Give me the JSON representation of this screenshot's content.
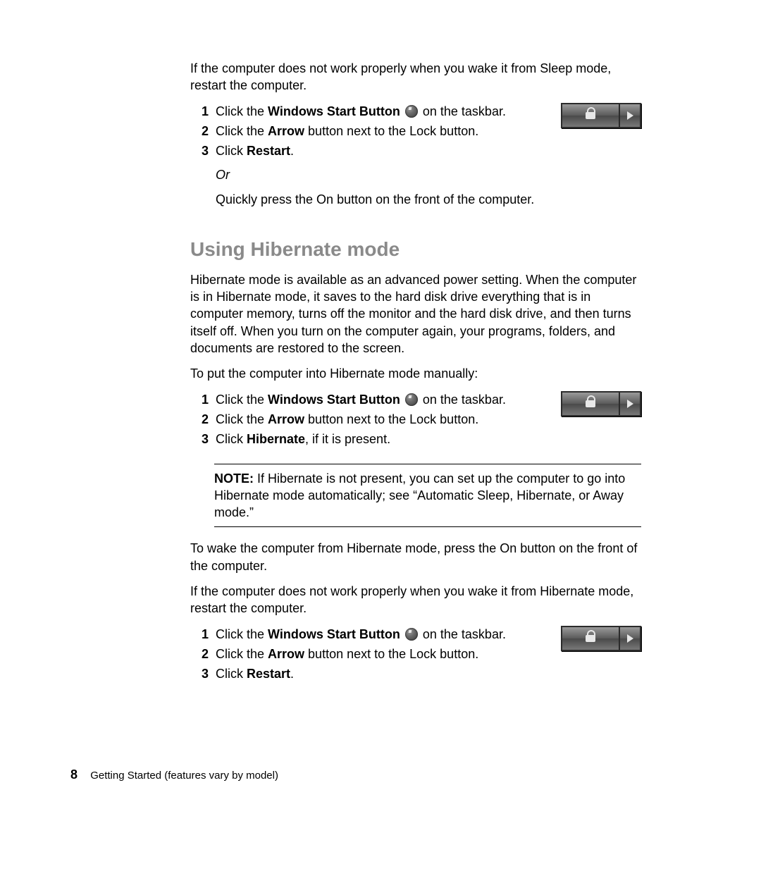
{
  "intro_sleep": "If the computer does not work properly when you wake it from Sleep mode, restart the computer.",
  "steps_a": {
    "1": {
      "pre": "Click the ",
      "bold": "Windows Start Button",
      "post": " on the taskbar."
    },
    "2": {
      "pre": "Click the ",
      "bold": "Arrow",
      "post": " button next to the Lock button."
    },
    "3": {
      "pre": "Click ",
      "bold": "Restart",
      "post": "."
    },
    "or": "Or",
    "orline": "Quickly press the On button on the front of the computer."
  },
  "heading": "Using Hibernate mode",
  "hibernate_desc": "Hibernate mode is available as an advanced power setting. When the computer is in Hibernate mode, it saves to the hard disk drive everything that is in computer memory, turns off the monitor and the hard disk drive, and then turns itself off. When you turn on the computer again, your programs, folders, and documents are restored to the screen.",
  "hibernate_lead": "To put the computer into Hibernate mode manually:",
  "steps_b": {
    "1": {
      "pre": "Click the ",
      "bold": "Windows Start Button",
      "post": " on the taskbar."
    },
    "2": {
      "pre": "Click the ",
      "bold": "Arrow",
      "post": " button next to the Lock button."
    },
    "3": {
      "pre": "Click ",
      "bold": "Hibernate",
      "post": ", if it is present."
    }
  },
  "note": {
    "label": "NOTE:",
    "text": " If Hibernate is not present, you can set up the computer to go into Hibernate mode automatically; see “Automatic Sleep, Hibernate, or Away mode.”"
  },
  "wake_text": "To wake the computer from Hibernate mode, press the On button on the front of the computer.",
  "intro_hib_restart": "If the computer does not work properly when you wake it from Hibernate mode, restart the computer.",
  "steps_c": {
    "1": {
      "pre": "Click the ",
      "bold": "Windows Start Button",
      "post": " on the taskbar."
    },
    "2": {
      "pre": "Click the ",
      "bold": "Arrow",
      "post": " button next to the Lock button."
    },
    "3": {
      "pre": "Click ",
      "bold": "Restart",
      "post": "."
    }
  },
  "footer": {
    "page": "8",
    "title": "Getting Started (features vary by model)"
  },
  "nums": {
    "n1": "1",
    "n2": "2",
    "n3": "3"
  }
}
